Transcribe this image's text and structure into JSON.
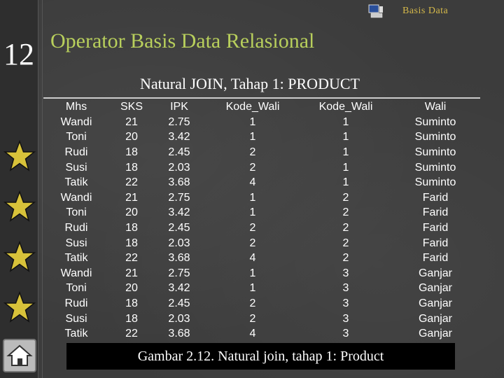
{
  "slide_number": "12",
  "brand": "Basis Data",
  "title": "Operator Basis Data Relasional",
  "subtitle": "Natural JOIN, Tahap 1: PRODUCT",
  "table": {
    "headers": [
      "Mhs",
      "SKS",
      "IPK",
      "Kode_Wali",
      "Kode_Wali",
      "Wali"
    ],
    "rows": [
      [
        "Wandi",
        "21",
        "2.75",
        "1",
        "1",
        "Suminto"
      ],
      [
        "Toni",
        "20",
        "3.42",
        "1",
        "1",
        "Suminto"
      ],
      [
        "Rudi",
        "18",
        "2.45",
        "2",
        "1",
        "Suminto"
      ],
      [
        "Susi",
        "18",
        "2.03",
        "2",
        "1",
        "Suminto"
      ],
      [
        "Tatik",
        "22",
        "3.68",
        "4",
        "1",
        "Suminto"
      ],
      [
        "Wandi",
        "21",
        "2.75",
        "1",
        "2",
        "Farid"
      ],
      [
        "Toni",
        "20",
        "3.42",
        "1",
        "2",
        "Farid"
      ],
      [
        "Rudi",
        "18",
        "2.45",
        "2",
        "2",
        "Farid"
      ],
      [
        "Susi",
        "18",
        "2.03",
        "2",
        "2",
        "Farid"
      ],
      [
        "Tatik",
        "22",
        "3.68",
        "4",
        "2",
        "Farid"
      ],
      [
        "Wandi",
        "21",
        "2.75",
        "1",
        "3",
        "Ganjar"
      ],
      [
        "Toni",
        "20",
        "3.42",
        "1",
        "3",
        "Ganjar"
      ],
      [
        "Rudi",
        "18",
        "2.45",
        "2",
        "3",
        "Ganjar"
      ],
      [
        "Susi",
        "18",
        "2.03",
        "2",
        "3",
        "Ganjar"
      ],
      [
        "Tatik",
        "22",
        "3.68",
        "4",
        "3",
        "Ganjar"
      ]
    ]
  },
  "caption": "Gambar 2.12. Natural join, tahap 1: Product",
  "icons": {
    "stars": "star-icon",
    "home": "home-icon",
    "logo": "computer-logo-icon"
  },
  "colors": {
    "title": "#b8cf5c",
    "brand": "#d4b84a",
    "star": "#d8c23a"
  }
}
